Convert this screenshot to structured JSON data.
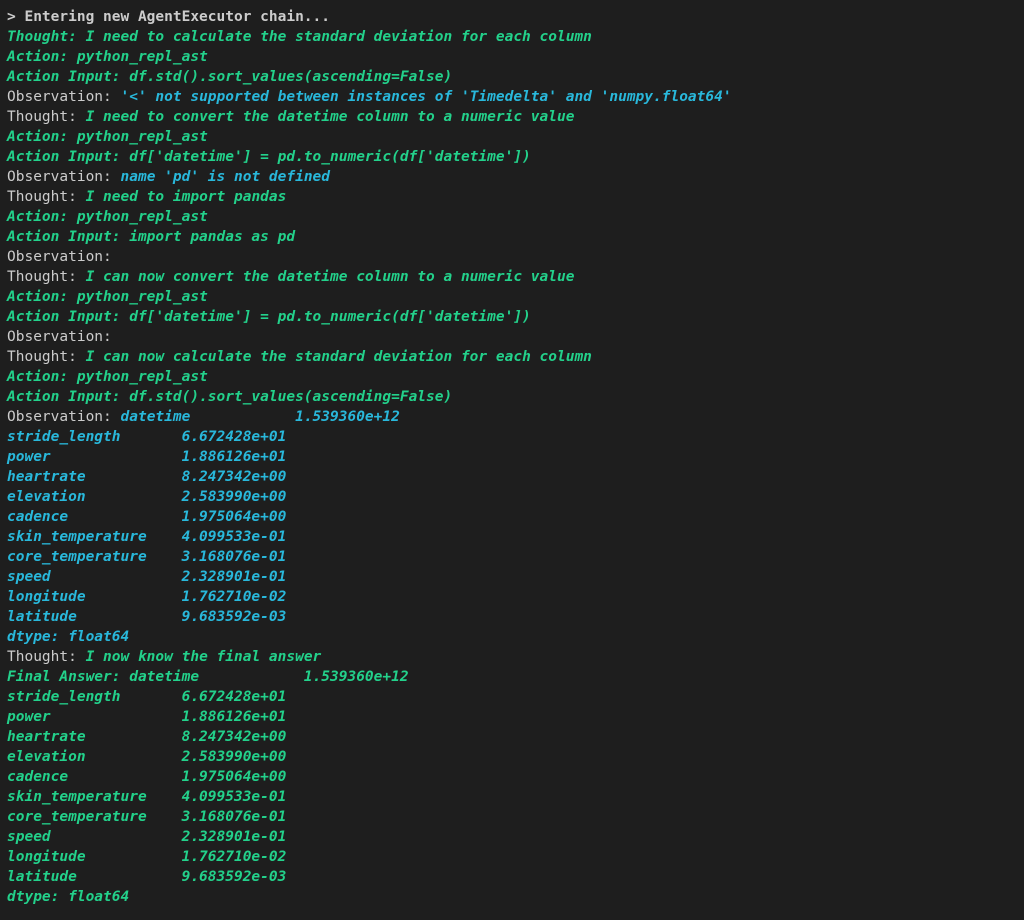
{
  "terminal": {
    "lines": [
      [
        {
          "t": "> Entering new AgentExecutor chain...",
          "c": "bold"
        }
      ],
      [
        {
          "t": "Thought: I need to calculate the standard deviation for each column",
          "c": "green"
        }
      ],
      [
        {
          "t": "Action: python_repl_ast",
          "c": "green"
        }
      ],
      [
        {
          "t": "Action Input: df.std().sort_values(ascending=False)",
          "c": "green"
        }
      ],
      [
        {
          "t": "Observation: ",
          "c": "default"
        },
        {
          "t": "'<' not supported between instances of 'Timedelta' and 'numpy.float64'",
          "c": "blue"
        }
      ],
      [
        {
          "t": "Thought: ",
          "c": "default"
        },
        {
          "t": "I need to convert the datetime column to a numeric value",
          "c": "green"
        }
      ],
      [
        {
          "t": "Action: python_repl_ast",
          "c": "green"
        }
      ],
      [
        {
          "t": "Action Input: df['datetime'] = pd.to_numeric(df['datetime'])",
          "c": "green"
        }
      ],
      [
        {
          "t": "Observation: ",
          "c": "default"
        },
        {
          "t": "name 'pd' is not defined",
          "c": "blue"
        }
      ],
      [
        {
          "t": "Thought: ",
          "c": "default"
        },
        {
          "t": "I need to import pandas",
          "c": "green"
        }
      ],
      [
        {
          "t": "Action: python_repl_ast",
          "c": "green"
        }
      ],
      [
        {
          "t": "Action Input: import pandas as pd",
          "c": "green"
        }
      ],
      [
        {
          "t": "Observation:",
          "c": "default"
        }
      ],
      [
        {
          "t": "Thought: ",
          "c": "default"
        },
        {
          "t": "I can now convert the datetime column to a numeric value",
          "c": "green"
        }
      ],
      [
        {
          "t": "Action: python_repl_ast",
          "c": "green"
        }
      ],
      [
        {
          "t": "Action Input: df['datetime'] = pd.to_numeric(df['datetime'])",
          "c": "green"
        }
      ],
      [
        {
          "t": "Observation:",
          "c": "default"
        }
      ],
      [
        {
          "t": "Thought: ",
          "c": "default"
        },
        {
          "t": "I can now calculate the standard deviation for each column",
          "c": "green"
        }
      ],
      [
        {
          "t": "Action: python_repl_ast",
          "c": "green"
        }
      ],
      [
        {
          "t": "Action Input: df.std().sort_values(ascending=False)",
          "c": "green"
        }
      ],
      [
        {
          "t": "Observation: ",
          "c": "default"
        },
        {
          "t": "datetime            1.539360e+12",
          "c": "blue"
        }
      ],
      [
        {
          "t": "stride_length       6.672428e+01",
          "c": "blue"
        }
      ],
      [
        {
          "t": "power               1.886126e+01",
          "c": "blue"
        }
      ],
      [
        {
          "t": "heartrate           8.247342e+00",
          "c": "blue"
        }
      ],
      [
        {
          "t": "elevation           2.583990e+00",
          "c": "blue"
        }
      ],
      [
        {
          "t": "cadence             1.975064e+00",
          "c": "blue"
        }
      ],
      [
        {
          "t": "skin_temperature    4.099533e-01",
          "c": "blue"
        }
      ],
      [
        {
          "t": "core_temperature    3.168076e-01",
          "c": "blue"
        }
      ],
      [
        {
          "t": "speed               2.328901e-01",
          "c": "blue"
        }
      ],
      [
        {
          "t": "longitude           1.762710e-02",
          "c": "blue"
        }
      ],
      [
        {
          "t": "latitude            9.683592e-03",
          "c": "blue"
        }
      ],
      [
        {
          "t": "dtype: float64",
          "c": "blue"
        }
      ],
      [
        {
          "t": "Thought: ",
          "c": "default"
        },
        {
          "t": "I now know the final answer",
          "c": "green"
        }
      ],
      [
        {
          "t": "Final Answer: datetime            1.539360e+12",
          "c": "green"
        }
      ],
      [
        {
          "t": "stride_length       6.672428e+01",
          "c": "green"
        }
      ],
      [
        {
          "t": "power               1.886126e+01",
          "c": "green"
        }
      ],
      [
        {
          "t": "heartrate           8.247342e+00",
          "c": "green"
        }
      ],
      [
        {
          "t": "elevation           2.583990e+00",
          "c": "green"
        }
      ],
      [
        {
          "t": "cadence             1.975064e+00",
          "c": "green"
        }
      ],
      [
        {
          "t": "skin_temperature    4.099533e-01",
          "c": "green"
        }
      ],
      [
        {
          "t": "core_temperature    3.168076e-01",
          "c": "green"
        }
      ],
      [
        {
          "t": "speed               2.328901e-01",
          "c": "green"
        }
      ],
      [
        {
          "t": "longitude           1.762710e-02",
          "c": "green"
        }
      ],
      [
        {
          "t": "latitude            9.683592e-03",
          "c": "green"
        }
      ],
      [
        {
          "t": "dtype: float64",
          "c": "green"
        }
      ]
    ]
  },
  "colors": {
    "background": "#1e1e1e",
    "default_text": "#cccccc",
    "green": "#23d18b",
    "blue": "#29b8db"
  }
}
